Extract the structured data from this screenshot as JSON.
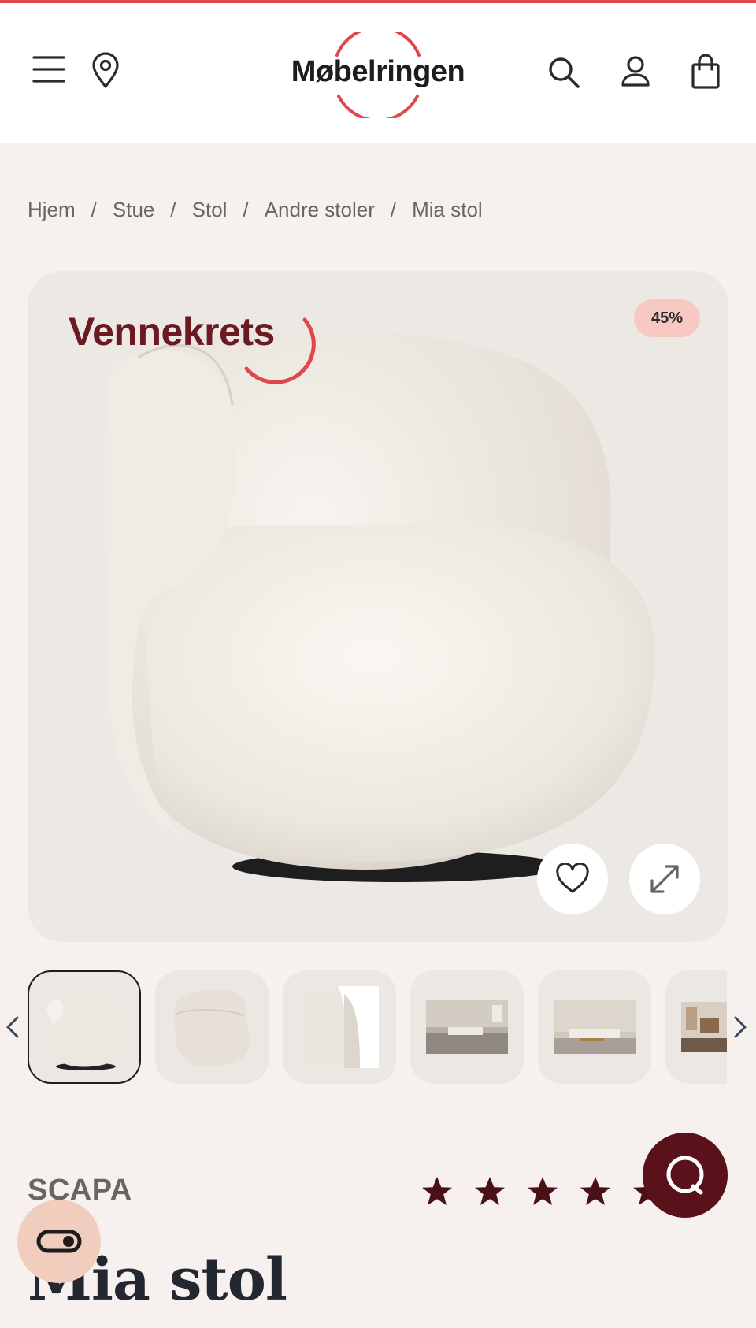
{
  "header": {
    "logo_text": "Møbelringen",
    "icons": [
      "menu-icon",
      "location-pin-icon",
      "search-icon",
      "account-icon",
      "shopping-bag-icon"
    ]
  },
  "breadcrumb": [
    "Hjem",
    "Stue",
    "Stol",
    "Andre stoler",
    "Mia stol"
  ],
  "breadcrumb_separator": "/",
  "hero": {
    "campaign_label": "Vennekrets",
    "discount_badge": "45%",
    "product_image": "cream-boucle-swivel-chair"
  },
  "gallery": {
    "thumbnail_count": 6,
    "active_index": 0
  },
  "product": {
    "brand": "SCAPA",
    "title": "Mia stol",
    "rating_stars": 5,
    "rating_count_visible": ")"
  },
  "colors": {
    "accent_red": "#e0474c",
    "brand_burgundy": "#5a1119",
    "background": "#f6f1ee"
  }
}
